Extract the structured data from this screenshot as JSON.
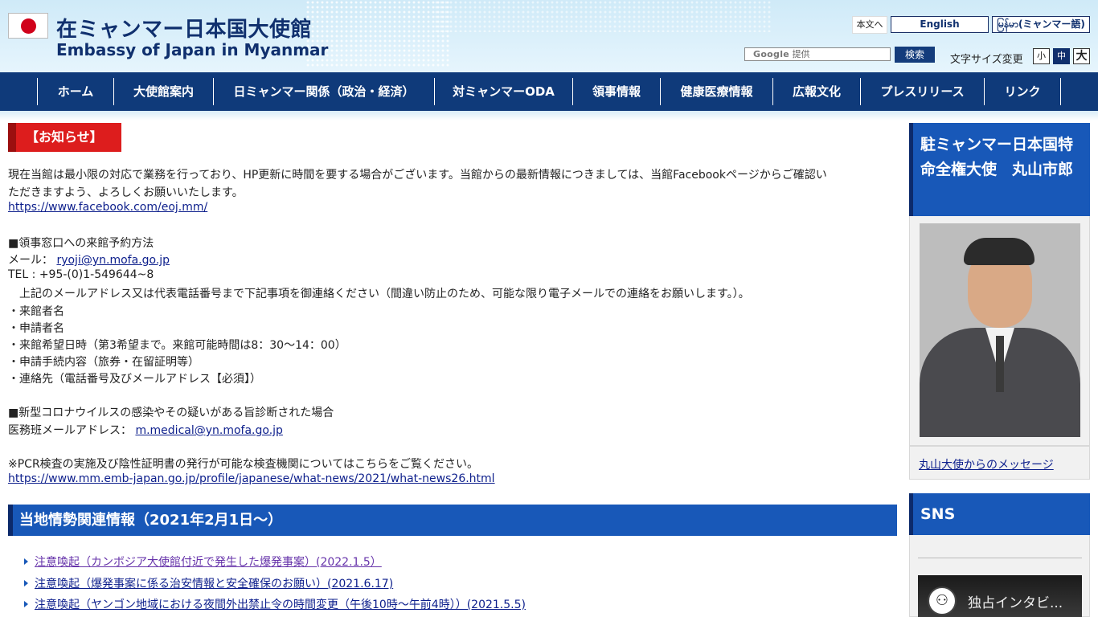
{
  "header": {
    "title_ja": "在ミャンマー日本国大使館",
    "title_en": "Embassy of Japan in Myanmar",
    "skip_link": "本文へ",
    "lang_en": "English",
    "lang_my": "မြန်မာ(ミャンマー語)",
    "search_brand": "Google",
    "search_provided": "提供",
    "search_button": "検索",
    "font_size_label": "文字サイズ変更",
    "font_small": "小",
    "font_medium": "中",
    "font_large": "大"
  },
  "nav": [
    {
      "label": "ホーム"
    },
    {
      "label": "大使館案内"
    },
    {
      "label": "日ミャンマー関係（政治・経済）"
    },
    {
      "label": "対ミャンマーODA"
    },
    {
      "label": "領事情報"
    },
    {
      "label": "健康医療情報"
    },
    {
      "label": "広報文化"
    },
    {
      "label": "プレスリリース"
    },
    {
      "label": "リンク"
    }
  ],
  "notice": {
    "tag": "【お知らせ】",
    "line1": "現在当館は最小限の対応で業務を行っており、HP更新に時間を要する場合がございます。当館からの最新情報につきましては、当館Facebookページからご確認い",
    "line2": "ただきますよう、よろしくお願いいたします。",
    "facebook_url": "https://www.facebook.com/eoj.mm/",
    "consular_heading": "■領事窓口への来館予約方法",
    "mail_label": "メール：",
    "mail_address": "ryoji@yn.mofa.go.jp",
    "tel": "TEL : +95-(0)1-549644~8",
    "instruction": "上記のメールアドレス又は代表電話番号まで下記事項を御連絡ください（間違い防止のため、可能な限り電子メールでの連絡をお願いします。）。",
    "items": [
      "・来館者名",
      "・申請者名",
      "・来館希望日時（第3希望まで。来館可能時間は8：30〜14：00）",
      "・申請手続内容（旅券・在留証明等）",
      "・連絡先（電話番号及びメールアドレス【必須】）"
    ],
    "covid_heading": "■新型コロナウイルスの感染やその疑いがある旨診断された場合",
    "medical_label": "医務班メールアドレス：",
    "medical_address": "m.medical@yn.mofa.go.jp",
    "pcr_note": "※PCR検査の実施及び陰性証明書の発行が可能な検査機関についてはこちらをご覧ください。",
    "pcr_url": "https://www.mm.emb-japan.go.jp/profile/japanese/what-news/2021/what-news26.html"
  },
  "situation": {
    "heading": "当地情勢関連情報（2021年2月1日〜）",
    "items": [
      {
        "text": "注意喚起（カンボジア大使館付近で発生した爆発事案）(2022.1.5）"
      },
      {
        "text": "注意喚起（爆発事案に係る治安情報と安全確保のお願い）(2021.6.17)"
      },
      {
        "text": "注意喚起（ヤンゴン地域における夜間外出禁止令の時間変更（午後10時〜午前4時））(2021.5.5)"
      }
    ]
  },
  "sidebar": {
    "ambassador_title": "駐ミャンマー日本国特命全権大使　丸山市郎",
    "ambassador_message": "丸山大使からのメッセージ",
    "sns_heading": "SNS",
    "video_title": "独占インタビ..."
  },
  "colors": {
    "navy": "#0f3a7a",
    "section_blue": "#1858b8",
    "notice_red": "#dd1d1d",
    "link": "#0d1f8c"
  }
}
